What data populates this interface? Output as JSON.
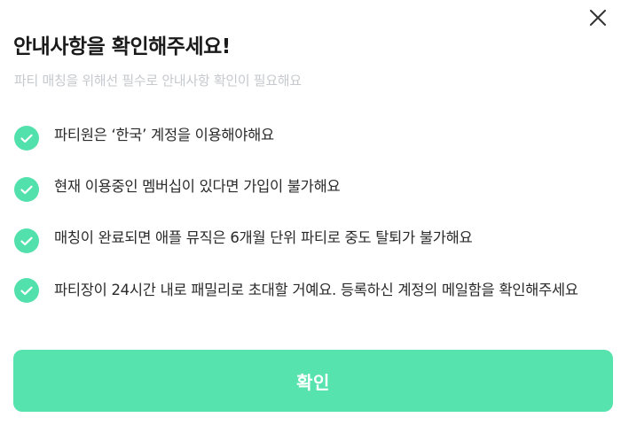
{
  "modal": {
    "title": "안내사항을 확인해주세요!",
    "subtitle": "파티 매칭을 위해선 필수로 안내사항 확인이 필요해요",
    "close_icon": "close-icon",
    "check_icon": "check-circle-icon",
    "accent_color": "#52e1ad",
    "notices": [
      {
        "text": "파티원은 ‘한국’ 계정을 이용해야해요"
      },
      {
        "text": "현재 이용중인 멤버십이 있다면 가입이 불가해요"
      },
      {
        "text": "매칭이 완료되면 애플 뮤직은 6개월 단위 파티로 중도 탈퇴가 불가해요"
      },
      {
        "text": "파티장이 24시간 내로 패밀리로 초대할 거예요. 등록하신 계정의 메일함을 확인해주세요"
      }
    ],
    "confirm_label": "확인"
  }
}
